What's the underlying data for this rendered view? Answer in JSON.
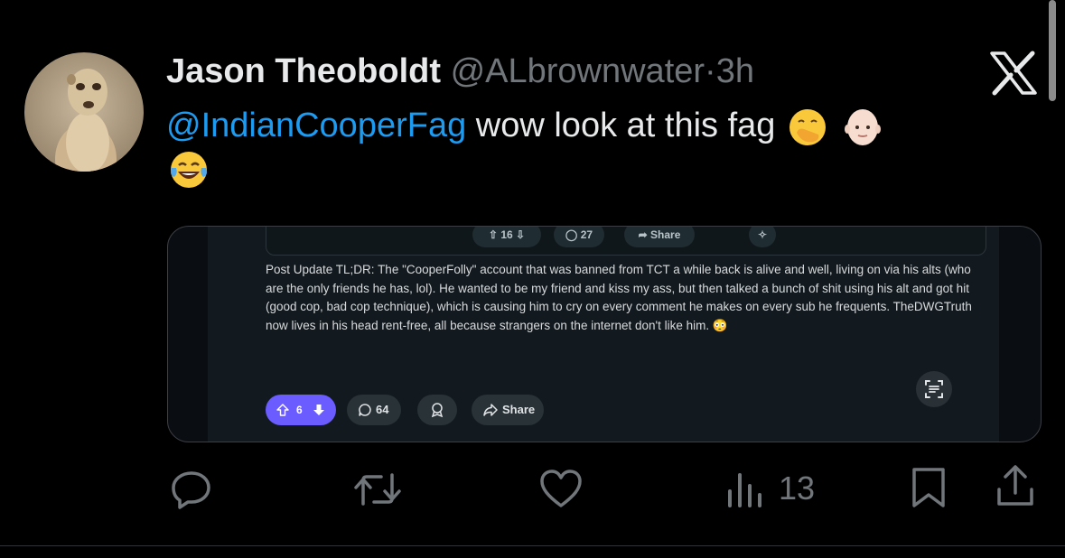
{
  "tweet": {
    "author_name": "Jason Theoboldt",
    "handle": "@ALbrownwater",
    "dot": "·",
    "time": "3h",
    "mention": "@IndianCooperFag",
    "text": " wow look at this fag"
  },
  "icons": {
    "x_logo": "x-logo-icon",
    "emoji_1": "face-with-hand-over-mouth-emoji",
    "emoji_2": "bald-person-emoji",
    "emoji_3": "face-with-tears-of-joy-emoji"
  },
  "embedded_post": {
    "top_vote_count": "16",
    "top_comment_count": "27",
    "top_share_label": "Share",
    "body": "Post Update TL;DR: The \"CooperFolly\" account that was banned from TCT a while back is alive and well, living on via his alts (who are the only friends he has, lol). He wanted to be my friend and kiss my ass, but then talked a bunch of shit using his alt and got hit (good cop, bad cop technique), which is causing him to cry on every comment he makes on every sub he frequents. TheDWGTruth now lives in his head rent-free, all because strangers on the internet don't like him. 😳",
    "vote_count": "6",
    "comment_count": "64",
    "share_label": "Share"
  },
  "actions": {
    "views_count": "13"
  },
  "colors": {
    "background": "#000000",
    "mention": "#1d9bf0",
    "muted": "#71767b",
    "vote_pill": "#6a5cff"
  }
}
